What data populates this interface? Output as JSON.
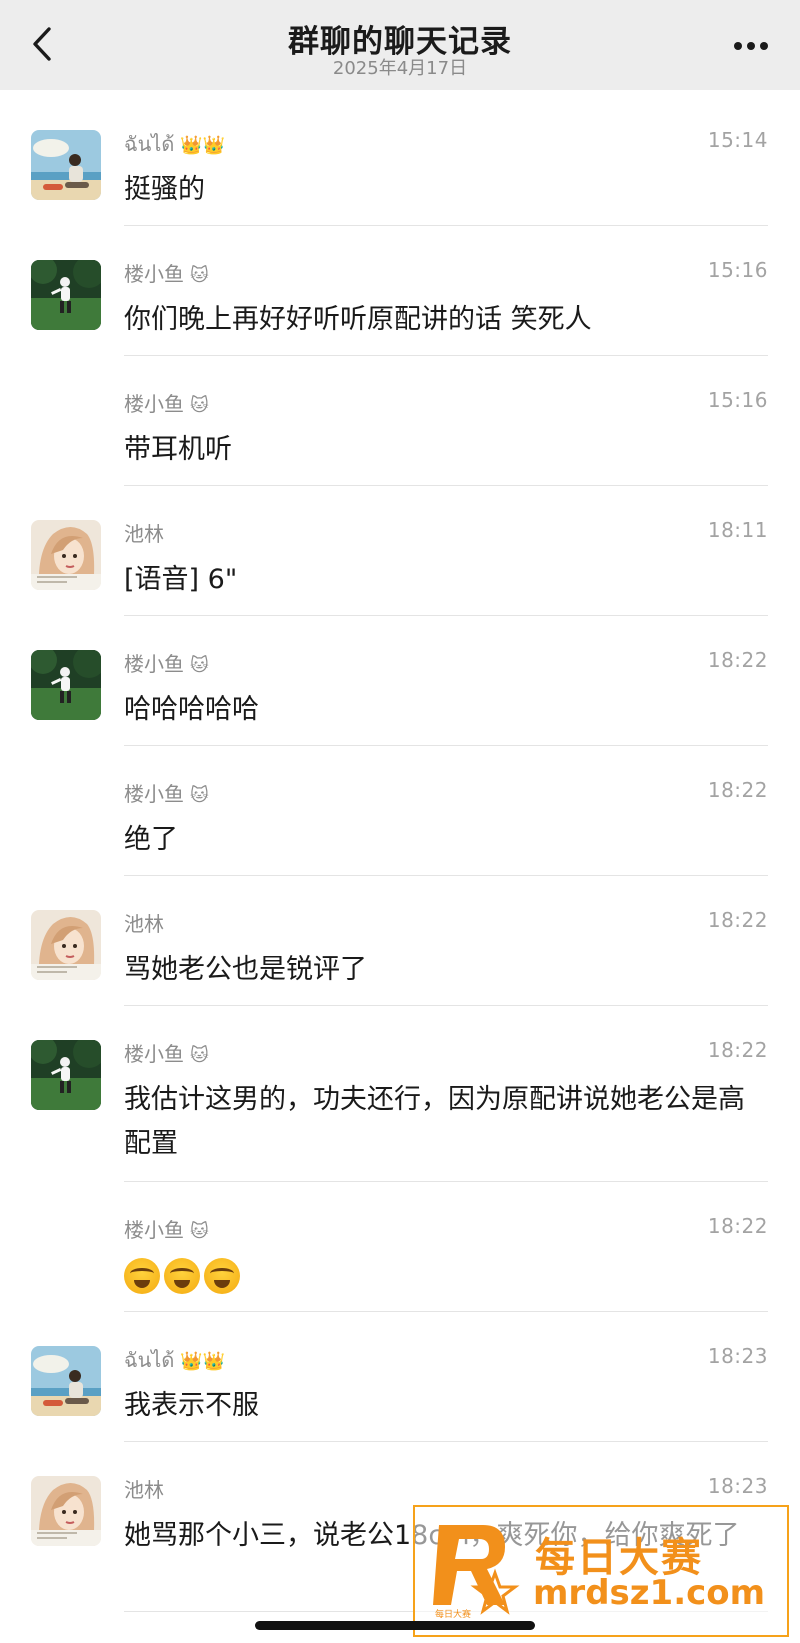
{
  "header": {
    "title": "群聊的聊天记录",
    "date": "2025年4月17日"
  },
  "messages": [
    {
      "sender": "ฉันได้",
      "deco": "👑👑",
      "time": "15:14",
      "text": "挺骚的",
      "avatar": "beach"
    },
    {
      "sender": "楼小鱼",
      "deco": "🐱",
      "time": "15:16",
      "text": "你们晚上再好好听听原配讲的话 笑死人",
      "avatar": "field"
    },
    {
      "sender": "楼小鱼",
      "deco": "🐱",
      "time": "15:16",
      "text": "带耳机听",
      "avatar": ""
    },
    {
      "sender": "池林",
      "deco": "",
      "time": "18:11",
      "text": "[语音] 6\"",
      "avatar": "girl"
    },
    {
      "sender": "楼小鱼",
      "deco": "🐱",
      "time": "18:22",
      "text": "哈哈哈哈哈",
      "avatar": "field"
    },
    {
      "sender": "楼小鱼",
      "deco": "🐱",
      "time": "18:22",
      "text": "绝了",
      "avatar": ""
    },
    {
      "sender": "池林",
      "deco": "",
      "time": "18:22",
      "text": "骂她老公也是锐评了",
      "avatar": "girl"
    },
    {
      "sender": "楼小鱼",
      "deco": "🐱",
      "time": "18:22",
      "text": "我估计这男的，功夫还行，因为原配讲说她老公是高配置",
      "avatar": "field"
    },
    {
      "sender": "楼小鱼",
      "deco": "🐱",
      "time": "18:22",
      "text": "",
      "avatar": "",
      "emoji_count": 3
    },
    {
      "sender": "ฉันได้",
      "deco": "👑👑",
      "time": "18:23",
      "text": "我表示不服",
      "avatar": "beach"
    },
    {
      "sender": "池林",
      "deco": "",
      "time": "18:23",
      "text": "她骂那个小三，说老公18cm，爽死你，给你爽死了",
      "avatar": "girl"
    }
  ],
  "watermark": {
    "line1": "每日大赛",
    "line2": "mrdsz1.com",
    "badge": "每日大赛"
  },
  "colors": {
    "nav_bg": "#ededed",
    "watermark": "#f2901b"
  }
}
